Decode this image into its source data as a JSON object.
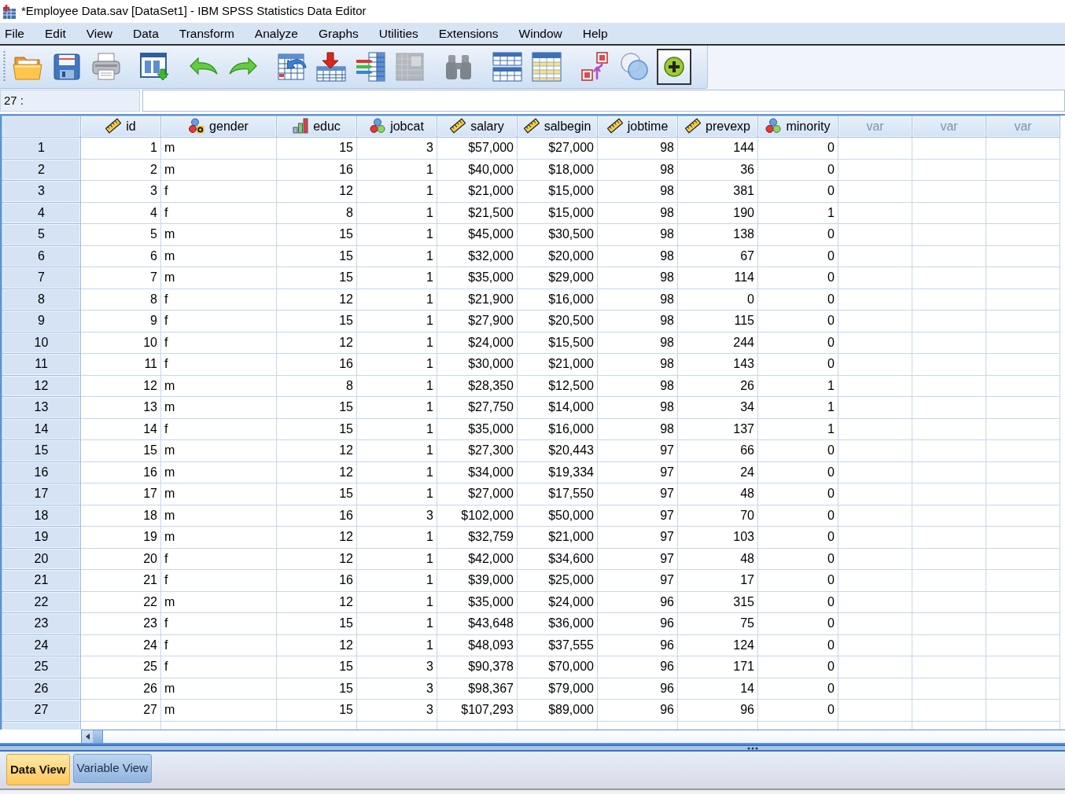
{
  "window": {
    "title": "*Employee Data.sav [DataSet1] - IBM SPSS Statistics Data Editor"
  },
  "menu": [
    "File",
    "Edit",
    "View",
    "Data",
    "Transform",
    "Analyze",
    "Graphs",
    "Utilities",
    "Extensions",
    "Window",
    "Help"
  ],
  "toolbar": [
    {
      "buttons": [
        {
          "kind": "open",
          "disabled": false,
          "pressed": false
        },
        {
          "kind": "save",
          "disabled": false,
          "pressed": false
        },
        {
          "kind": "print",
          "disabled": false,
          "pressed": false
        }
      ]
    },
    {
      "buttons": [
        {
          "kind": "recall-dialog",
          "disabled": false,
          "pressed": false
        }
      ]
    },
    {
      "buttons": [
        {
          "kind": "undo",
          "disabled": false,
          "pressed": false
        },
        {
          "kind": "redo",
          "disabled": false,
          "pressed": false
        }
      ]
    },
    {
      "buttons": [
        {
          "kind": "go-to-case",
          "disabled": false,
          "pressed": false
        },
        {
          "kind": "insert-cases",
          "disabled": false,
          "pressed": false
        },
        {
          "kind": "insert-variable",
          "disabled": false,
          "pressed": false
        },
        {
          "kind": "descriptives",
          "disabled": true,
          "pressed": false
        }
      ]
    },
    {
      "buttons": [
        {
          "kind": "find",
          "disabled": true,
          "pressed": false
        }
      ]
    },
    {
      "buttons": [
        {
          "kind": "split-file",
          "disabled": false,
          "pressed": false
        },
        {
          "kind": "select-cases",
          "disabled": false,
          "pressed": false
        }
      ]
    },
    {
      "buttons": [
        {
          "kind": "value-labels",
          "disabled": false,
          "pressed": false
        },
        {
          "kind": "sets",
          "disabled": false,
          "pressed": false
        },
        {
          "kind": "extension",
          "disabled": false,
          "pressed": true
        }
      ]
    }
  ],
  "cell_editor": {
    "reference": "27 :"
  },
  "columns": [
    {
      "name": "id",
      "kind": "scale",
      "string": false
    },
    {
      "name": "gender",
      "kind": "nominal",
      "string": true
    },
    {
      "name": "educ",
      "kind": "ordinal",
      "string": false
    },
    {
      "name": "jobcat",
      "kind": "nominal",
      "string": false
    },
    {
      "name": "salary",
      "kind": "scale",
      "string": false
    },
    {
      "name": "salbegin",
      "kind": "scale",
      "string": false
    },
    {
      "name": "jobtime",
      "kind": "scale",
      "string": false
    },
    {
      "name": "prevexp",
      "kind": "scale",
      "string": false
    },
    {
      "name": "minority",
      "kind": "nominal",
      "string": false
    },
    {
      "name": "var",
      "kind": "placeholder"
    },
    {
      "name": "var",
      "kind": "placeholder"
    },
    {
      "name": "var",
      "kind": "placeholder"
    }
  ],
  "rows": [
    {
      "label": "1",
      "cells": [
        "1",
        "m",
        "15",
        "3",
        "$57,000",
        "$27,000",
        "98",
        "144",
        "0"
      ]
    },
    {
      "label": "2",
      "cells": [
        "2",
        "m",
        "16",
        "1",
        "$40,000",
        "$18,000",
        "98",
        "36",
        "0"
      ]
    },
    {
      "label": "3",
      "cells": [
        "3",
        "f",
        "12",
        "1",
        "$21,000",
        "$15,000",
        "98",
        "381",
        "0"
      ]
    },
    {
      "label": "4",
      "cells": [
        "4",
        "f",
        "8",
        "1",
        "$21,500",
        "$15,000",
        "98",
        "190",
        "1"
      ]
    },
    {
      "label": "5",
      "cells": [
        "5",
        "m",
        "15",
        "1",
        "$45,000",
        "$30,500",
        "98",
        "138",
        "0"
      ]
    },
    {
      "label": "6",
      "cells": [
        "6",
        "m",
        "15",
        "1",
        "$32,000",
        "$20,000",
        "98",
        "67",
        "0"
      ]
    },
    {
      "label": "7",
      "cells": [
        "7",
        "m",
        "15",
        "1",
        "$35,000",
        "$29,000",
        "98",
        "114",
        "0"
      ]
    },
    {
      "label": "8",
      "cells": [
        "8",
        "f",
        "12",
        "1",
        "$21,900",
        "$16,000",
        "98",
        "0",
        "0"
      ]
    },
    {
      "label": "9",
      "cells": [
        "9",
        "f",
        "15",
        "1",
        "$27,900",
        "$20,500",
        "98",
        "115",
        "0"
      ]
    },
    {
      "label": "10",
      "cells": [
        "10",
        "f",
        "12",
        "1",
        "$24,000",
        "$15,500",
        "98",
        "244",
        "0"
      ]
    },
    {
      "label": "11",
      "cells": [
        "11",
        "f",
        "16",
        "1",
        "$30,000",
        "$21,000",
        "98",
        "143",
        "0"
      ]
    },
    {
      "label": "12",
      "cells": [
        "12",
        "m",
        "8",
        "1",
        "$28,350",
        "$12,500",
        "98",
        "26",
        "1"
      ]
    },
    {
      "label": "13",
      "cells": [
        "13",
        "m",
        "15",
        "1",
        "$27,750",
        "$14,000",
        "98",
        "34",
        "1"
      ]
    },
    {
      "label": "14",
      "cells": [
        "14",
        "f",
        "15",
        "1",
        "$35,000",
        "$16,000",
        "98",
        "137",
        "1"
      ]
    },
    {
      "label": "15",
      "cells": [
        "15",
        "m",
        "12",
        "1",
        "$27,300",
        "$20,443",
        "97",
        "66",
        "0"
      ]
    },
    {
      "label": "16",
      "cells": [
        "16",
        "m",
        "12",
        "1",
        "$34,000",
        "$19,334",
        "97",
        "24",
        "0"
      ]
    },
    {
      "label": "17",
      "cells": [
        "17",
        "m",
        "15",
        "1",
        "$27,000",
        "$17,550",
        "97",
        "48",
        "0"
      ]
    },
    {
      "label": "18",
      "cells": [
        "18",
        "m",
        "16",
        "3",
        "$102,000",
        "$50,000",
        "97",
        "70",
        "0"
      ]
    },
    {
      "label": "19",
      "cells": [
        "19",
        "m",
        "12",
        "1",
        "$32,759",
        "$21,000",
        "97",
        "103",
        "0"
      ]
    },
    {
      "label": "20",
      "cells": [
        "20",
        "f",
        "12",
        "1",
        "$42,000",
        "$34,600",
        "97",
        "48",
        "0"
      ]
    },
    {
      "label": "21",
      "cells": [
        "21",
        "f",
        "16",
        "1",
        "$39,000",
        "$25,000",
        "97",
        "17",
        "0"
      ]
    },
    {
      "label": "22",
      "cells": [
        "22",
        "m",
        "12",
        "1",
        "$35,000",
        "$24,000",
        "96",
        "315",
        "0"
      ]
    },
    {
      "label": "23",
      "cells": [
        "23",
        "f",
        "15",
        "1",
        "$43,648",
        "$36,000",
        "96",
        "75",
        "0"
      ]
    },
    {
      "label": "24",
      "cells": [
        "24",
        "f",
        "12",
        "1",
        "$48,093",
        "$37,555",
        "96",
        "124",
        "0"
      ]
    },
    {
      "label": "25",
      "cells": [
        "25",
        "f",
        "15",
        "3",
        "$90,378",
        "$70,000",
        "96",
        "171",
        "0"
      ]
    },
    {
      "label": "26",
      "cells": [
        "26",
        "m",
        "15",
        "3",
        "$98,367",
        "$79,000",
        "96",
        "14",
        "0"
      ]
    },
    {
      "label": "27",
      "cells": [
        "27",
        "m",
        "15",
        "3",
        "$107,293",
        "$89,000",
        "96",
        "96",
        "0"
      ]
    }
  ],
  "view_tabs": [
    {
      "label": "Data View",
      "selected": true
    },
    {
      "label": "Variable View",
      "selected": false
    }
  ]
}
